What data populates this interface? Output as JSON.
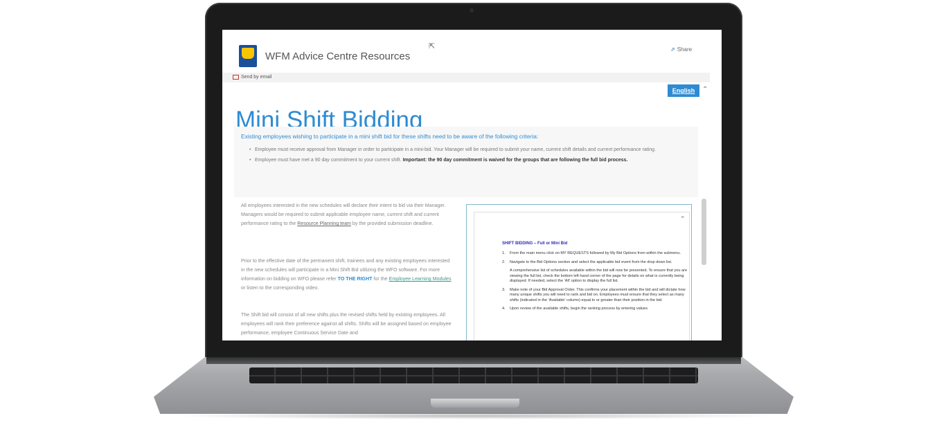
{
  "header": {
    "site_title": "WFM Advice Centre Resources",
    "share_label": "Share"
  },
  "toolbar": {
    "send_label": "Send by email"
  },
  "language_button": "English",
  "page": {
    "title": "Mini Shift Bidding"
  },
  "criteria": {
    "intro": "Existing employees wishing to participate in a mini shift bid for these shifts need to be aware of the following criteria:",
    "item1": "Employee must receive approval from Manager in order to participate in a mini-bid.  Your Manager will be required to submit your name, current shift details and current performance rating.",
    "item2_text": "Employee must have met a 90 day commitment to your current shift.",
    "item2_bold": "Important: the 90 day commitment is waived for the groups that are following the full bid process."
  },
  "body": {
    "p1_a": "All employees interested in the new schedules will declare their intent to bid via their Manager.  Managers would be required to submit applicable employee name, current shift and current performance rating to the",
    "p1_link": "Resource Planning team",
    "p1_b": "by the provided submission deadline.",
    "p2_a": "Prior to the effective date of the permanent shift, trainees and any existing employees interested in the new schedules will participate in a Mini Shift Bid utilizing the WFO software.   For more information on bidding on WFO please refer",
    "p2_hl": "TO THE RIGHT",
    "p2_b": "for the",
    "p2_link": "Employee Learning Modules",
    "p2_c": "or listen to the corresponding video.",
    "p3": "The Shift bid will consist of all new shifts plus the revised shifts held by existing employees.  All employees will rank their preference against all shifts.  Shifts will be assigned based on employee performance, employee Continuous Service Date and"
  },
  "doc": {
    "heading": "SHIFT BIDDING – Full or Mini Bid",
    "steps": [
      {
        "num": "1.",
        "text": "From the main menu click on MY REQUESTS followed by My Bid Options from within the submenu."
      },
      {
        "num": "2.",
        "text": "Navigate to the Bid Options section and select the applicable bid event from the drop down list.",
        "sub": "A comprehensive list of schedules available within the bid will now be presented. To ensure that you are viewing the full list, check the bottom left hand corner of the page for details on what is currently being displayed. If needed, select the 'All' option to display the full list."
      },
      {
        "num": "3.",
        "text": "Make note of your Bid Approval Order. This confirms your placement within the bid and will dictate how many unique shifts you will need to rank and bid on. Employees must ensure that they select as many shifts (indicated in the 'Available' column) equal to or greater than their position in the bid."
      },
      {
        "num": "4.",
        "text": "Upon review of the available shifts, begin the ranking process by entering values"
      }
    ]
  },
  "colors": {
    "accent": "#2e8bd2",
    "heading_blue": "#2d2db3"
  }
}
